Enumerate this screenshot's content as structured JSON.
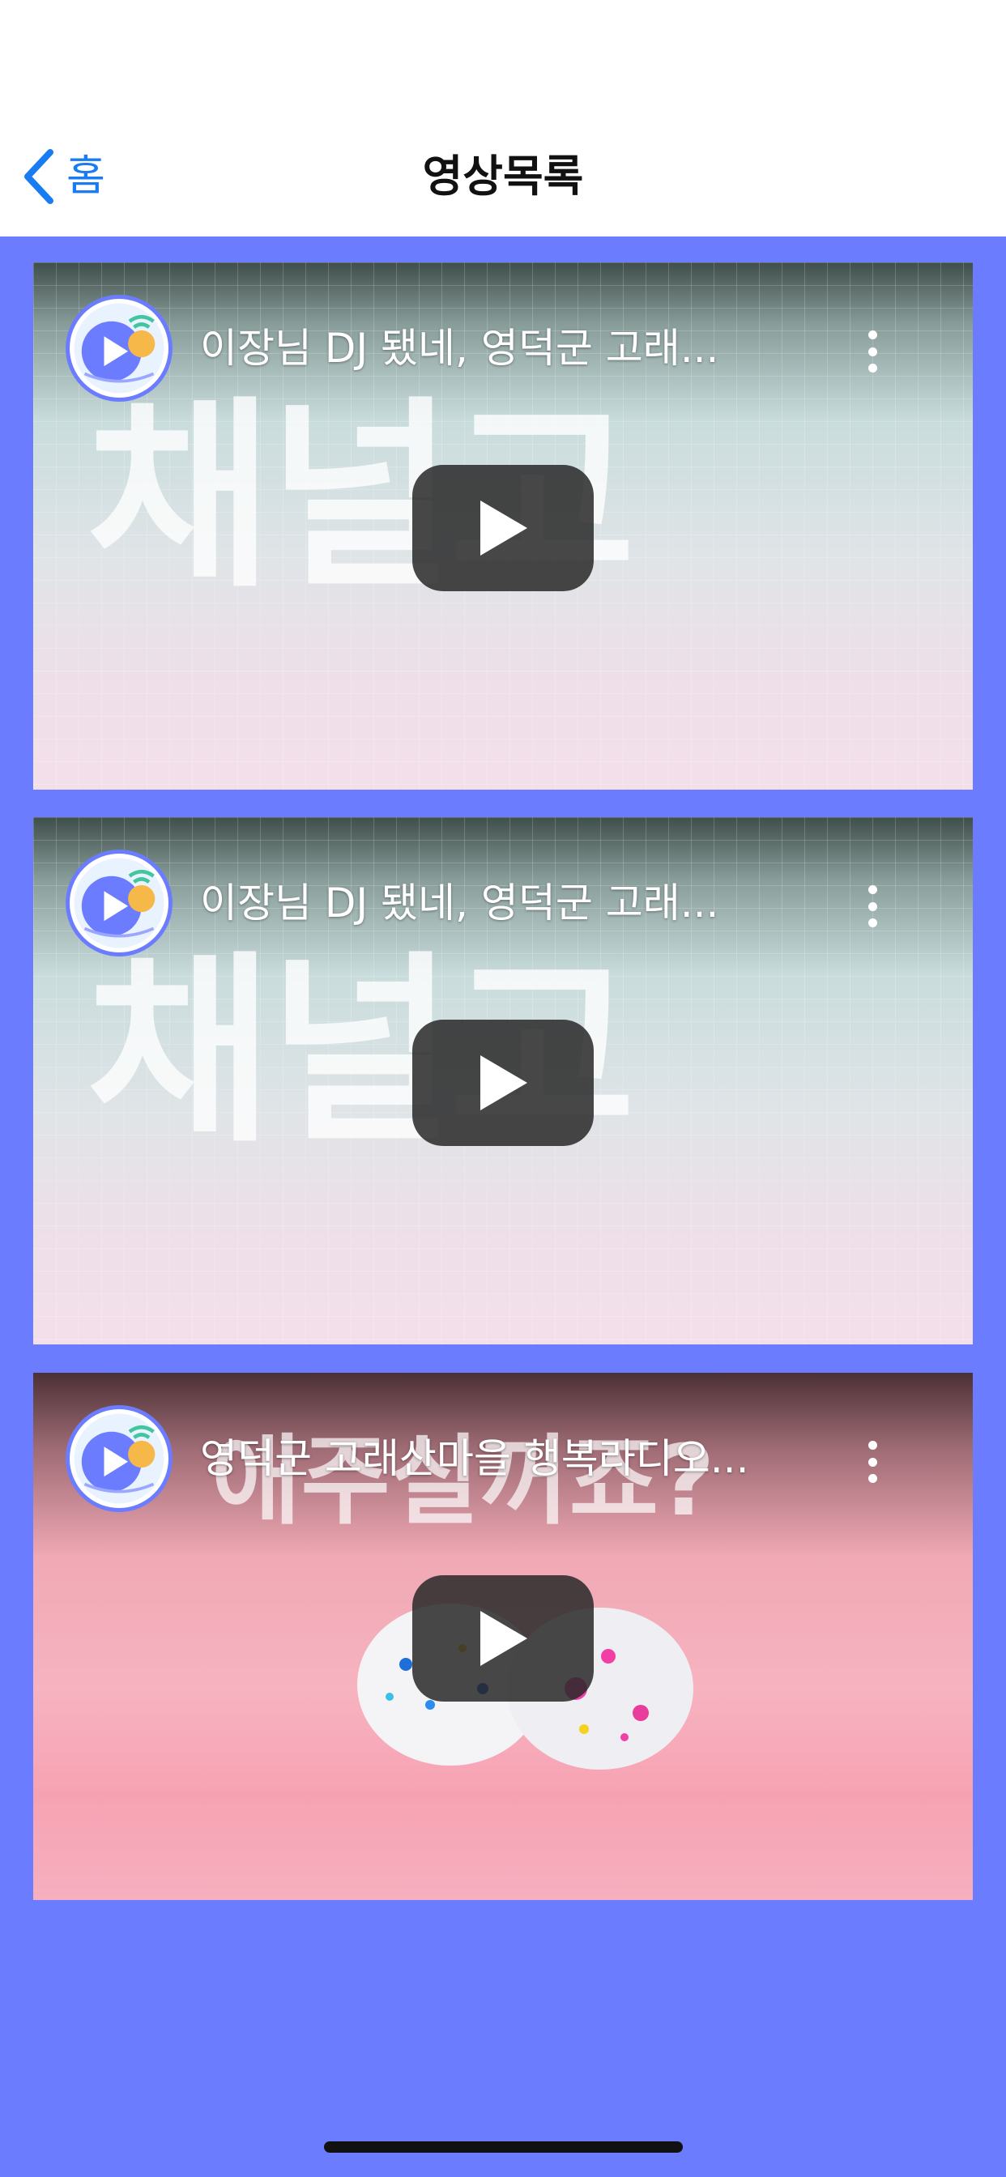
{
  "nav": {
    "back_label": "홈",
    "title": "영상목록"
  },
  "videos": [
    {
      "title": "이장님 DJ 됐네, 영덕군 고래...",
      "thumb_text": "채널고"
    },
    {
      "title": "이장님 DJ 됐네, 영덕군 고래...",
      "thumb_text": "채널고"
    },
    {
      "title": "영덕군 고래산마을 행복라디오...",
      "thumb_text": "애주실꺼죠?"
    }
  ],
  "colors": {
    "background": "#6b7cff",
    "accent": "#1a7cf3"
  },
  "icons": [
    "chevron-left-icon",
    "channel-logo-icon",
    "more-vert-icon",
    "play-icon"
  ]
}
